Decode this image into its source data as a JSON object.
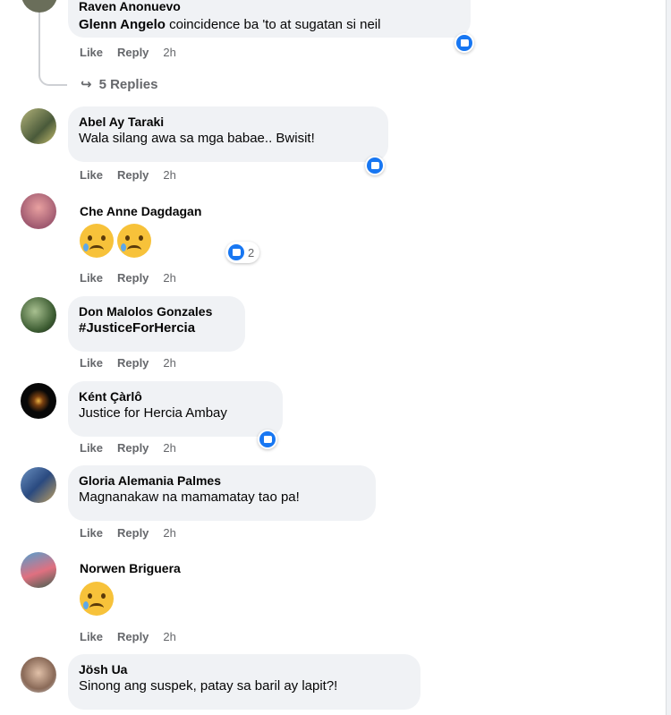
{
  "top_comment": {
    "author_partial": "Raven Anonuevo",
    "mention": "Glenn Angelo",
    "text": " coincidence ba 'to at sugatan si neil",
    "like": "Like",
    "reply": "Reply",
    "time": "2h",
    "replies": "5 Replies"
  },
  "comments": [
    {
      "author": "Abel Ay Taraki",
      "text": "Wala silang awa sa mga babae.. Bwisit!",
      "like": "Like",
      "reply": "Reply",
      "time": "2h"
    },
    {
      "author": "Che Anne Dagdagan",
      "text": "",
      "like": "Like",
      "reply": "Reply",
      "time": "2h",
      "reaction_count": "2"
    },
    {
      "author": "Don Malolos Gonzales",
      "text": "#JusticeForHercia",
      "like": "Like",
      "reply": "Reply",
      "time": "2h"
    },
    {
      "author": "Ként Çàrlô",
      "text": "Justice for Hercia Ambay",
      "like": "Like",
      "reply": "Reply",
      "time": "2h"
    },
    {
      "author": "Gloria Alemania Palmes",
      "text": "Magnanakaw na mamamatay tao pa!",
      "like": "Like",
      "reply": "Reply",
      "time": "2h"
    },
    {
      "author": "Norwen Briguera",
      "text": "",
      "like": "Like",
      "reply": "Reply",
      "time": "2h"
    },
    {
      "author": "Jösh Ua",
      "text": "Sinong ang suspek, patay sa baril ay lapit?!"
    }
  ],
  "colors": {
    "bubble": "#f0f2f5",
    "like_blue": "#1877f2",
    "meta": "#65676b"
  }
}
